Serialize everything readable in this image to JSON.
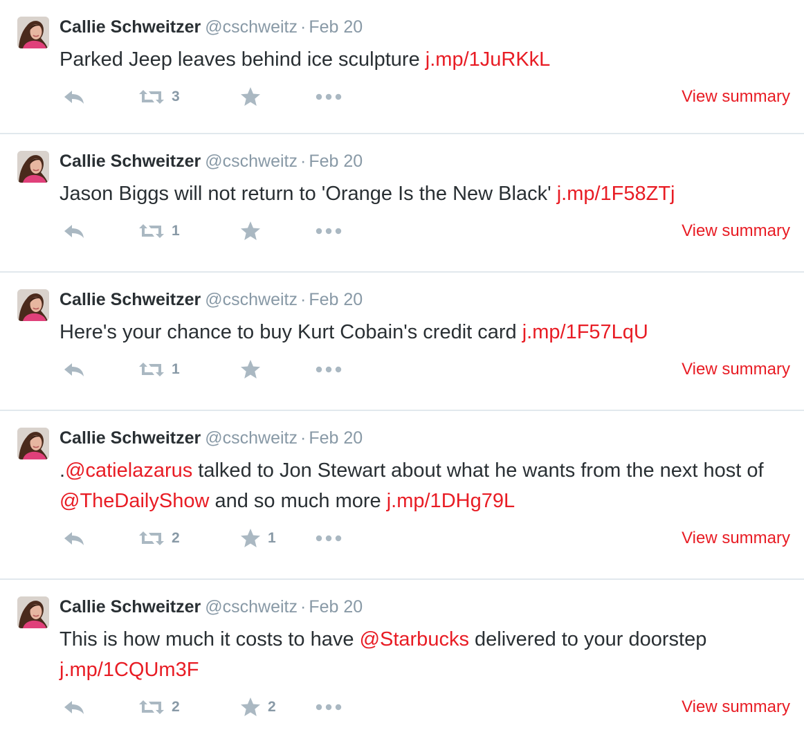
{
  "colors": {
    "link": "#e81c24",
    "action_icon": "#aab8c2",
    "meta_text": "#8899a6",
    "divider": "#e1e8ed",
    "body_text": "#292f33"
  },
  "tweets": [
    {
      "author": "Callie Schweitzer",
      "handle": "@cschweitz",
      "separator": "·",
      "date": "Feb 20",
      "text_parts": [
        {
          "kind": "text",
          "value": "Parked Jeep leaves behind ice sculpture "
        },
        {
          "kind": "link",
          "value": "j.mp/1JuRKkL"
        }
      ],
      "retweet_count": "3",
      "favorite_count": "",
      "summary_label": "View summary"
    },
    {
      "author": "Callie Schweitzer",
      "handle": "@cschweitz",
      "separator": "·",
      "date": "Feb 20",
      "text_parts": [
        {
          "kind": "text",
          "value": "Jason Biggs will not return to 'Orange Is the New Black' "
        },
        {
          "kind": "link",
          "value": "j.mp/1F58ZTj"
        }
      ],
      "retweet_count": "1",
      "favorite_count": "",
      "summary_label": "View summary"
    },
    {
      "author": "Callie Schweitzer",
      "handle": "@cschweitz",
      "separator": "·",
      "date": "Feb 20",
      "text_parts": [
        {
          "kind": "text",
          "value": "Here's your chance to buy Kurt Cobain's credit card "
        },
        {
          "kind": "link",
          "value": "j.mp/1F57LqU"
        }
      ],
      "retweet_count": "1",
      "favorite_count": "",
      "summary_label": "View summary"
    },
    {
      "author": "Callie Schweitzer",
      "handle": "@cschweitz",
      "separator": "·",
      "date": "Feb 20",
      "text_parts": [
        {
          "kind": "text",
          "value": "."
        },
        {
          "kind": "mention",
          "value": "@catielazarus"
        },
        {
          "kind": "text",
          "value": " talked to Jon Stewart about what he wants from the next host of "
        },
        {
          "kind": "mention",
          "value": "@TheDailyShow"
        },
        {
          "kind": "text",
          "value": " and so much more "
        },
        {
          "kind": "link",
          "value": "j.mp/1DHg79L"
        }
      ],
      "retweet_count": "2",
      "favorite_count": "1",
      "summary_label": "View summary"
    },
    {
      "author": "Callie Schweitzer",
      "handle": "@cschweitz",
      "separator": "·",
      "date": "Feb 20",
      "text_parts": [
        {
          "kind": "text",
          "value": "This is how much it costs to have "
        },
        {
          "kind": "mention",
          "value": "@Starbucks"
        },
        {
          "kind": "text",
          "value": " delivered to your doorstep "
        },
        {
          "kind": "link",
          "value": "j.mp/1CQUm3F"
        }
      ],
      "retweet_count": "2",
      "favorite_count": "2",
      "summary_label": "View summary"
    }
  ]
}
